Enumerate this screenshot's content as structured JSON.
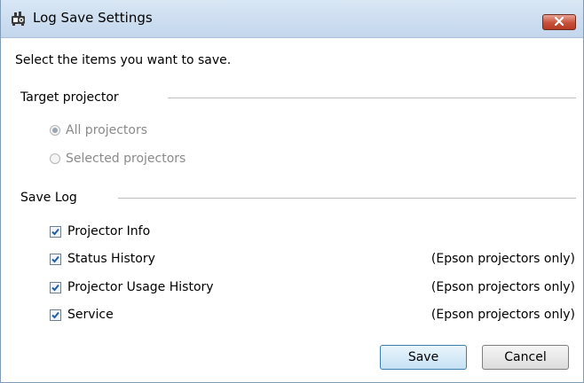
{
  "window": {
    "title": "Log Save Settings",
    "title_icon": "projector-log-icon",
    "close_icon": "close-icon"
  },
  "instructions": "Select the items you want to save.",
  "target_projector": {
    "label": "Target projector",
    "options": [
      {
        "label": "All projectors",
        "selected": true,
        "enabled": false
      },
      {
        "label": "Selected projectors",
        "selected": false,
        "enabled": false
      }
    ]
  },
  "save_log": {
    "label": "Save Log",
    "items": [
      {
        "label": "Projector Info",
        "checked": true,
        "note": ""
      },
      {
        "label": "Status History",
        "checked": true,
        "note": "(Epson projectors only)"
      },
      {
        "label": "Projector Usage History",
        "checked": true,
        "note": "(Epson projectors only)"
      },
      {
        "label": "Service",
        "checked": true,
        "note": "(Epson projectors only)"
      }
    ]
  },
  "buttons": {
    "save_label": "Save",
    "cancel_label": "Cancel"
  },
  "colors": {
    "titlebar": "#c3d6ec",
    "close_button": "#c7503a",
    "checkmark": "#1f5fa8",
    "default_button_border": "#3c7fb1"
  }
}
